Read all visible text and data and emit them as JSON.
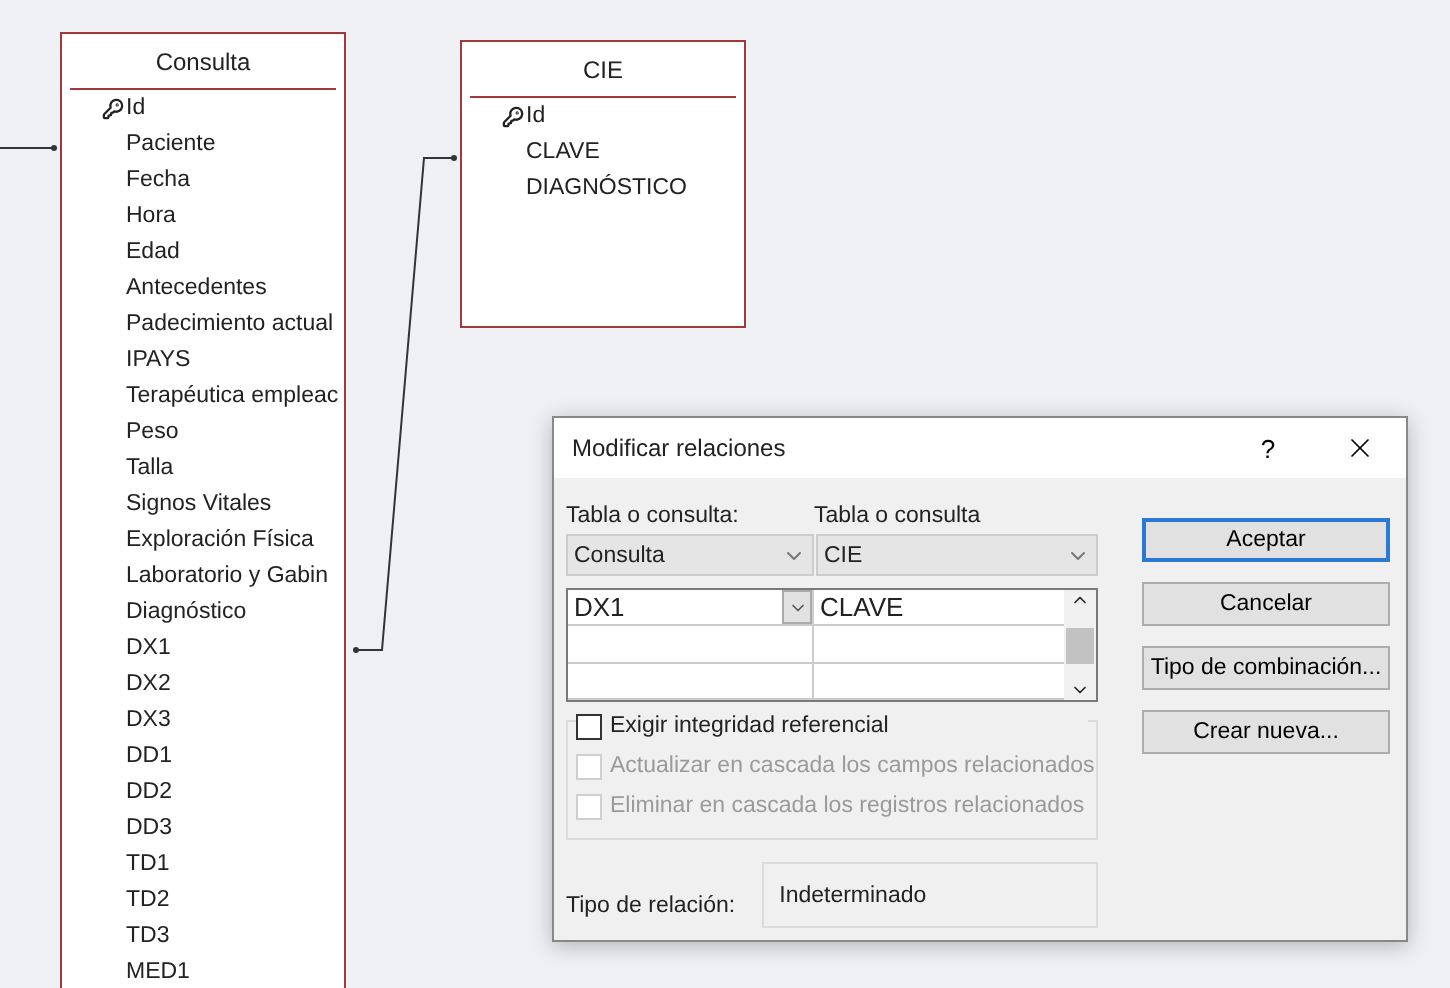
{
  "tables": [
    {
      "title": "Consulta",
      "fields": [
        {
          "name": "Id",
          "key": true
        },
        {
          "name": "Paciente",
          "key": false
        },
        {
          "name": "Fecha",
          "key": false
        },
        {
          "name": "Hora",
          "key": false
        },
        {
          "name": "Edad",
          "key": false
        },
        {
          "name": "Antecedentes",
          "key": false
        },
        {
          "name": "Padecimiento actual",
          "key": false
        },
        {
          "name": "IPAYS",
          "key": false
        },
        {
          "name": "Terapéutica empleac",
          "key": false
        },
        {
          "name": "Peso",
          "key": false
        },
        {
          "name": "Talla",
          "key": false
        },
        {
          "name": "Signos Vitales",
          "key": false
        },
        {
          "name": "Exploración Física",
          "key": false
        },
        {
          "name": "Laboratorio y Gabin",
          "key": false
        },
        {
          "name": "Diagnóstico",
          "key": false
        },
        {
          "name": "DX1",
          "key": false
        },
        {
          "name": "DX2",
          "key": false
        },
        {
          "name": "DX3",
          "key": false
        },
        {
          "name": "DD1",
          "key": false
        },
        {
          "name": "DD2",
          "key": false
        },
        {
          "name": "DD3",
          "key": false
        },
        {
          "name": "TD1",
          "key": false
        },
        {
          "name": "TD2",
          "key": false
        },
        {
          "name": "TD3",
          "key": false
        },
        {
          "name": "MED1",
          "key": false
        }
      ]
    },
    {
      "title": "CIE",
      "fields": [
        {
          "name": "Id",
          "key": true
        },
        {
          "name": "CLAVE",
          "key": false
        },
        {
          "name": "DIAGNÓSTICO",
          "key": false
        }
      ]
    }
  ],
  "dialog": {
    "title": "Modificar relaciones",
    "help": "?",
    "left_label": "Tabla o consulta:",
    "right_label": "Tabla o consulta",
    "left_table": "Consulta",
    "right_table": "CIE",
    "grid_rows": [
      {
        "left": "DX1",
        "right": "CLAVE"
      }
    ],
    "checkboxes": [
      {
        "label": "Exigir integridad referencial",
        "checked": false,
        "disabled": false
      },
      {
        "label": "Actualizar en cascada los campos relacionados",
        "checked": false,
        "disabled": true
      },
      {
        "label": "Eliminar en cascada los registros relacionados",
        "checked": false,
        "disabled": true
      }
    ],
    "relation_label": "Tipo de relación:",
    "relation_value": "Indeterminado",
    "buttons": [
      {
        "label": "Aceptar",
        "default": true
      },
      {
        "label": "Cancelar",
        "default": false
      },
      {
        "label": "Tipo de combinación...",
        "default": false
      },
      {
        "label": "Crear nueva...",
        "default": false
      }
    ]
  }
}
